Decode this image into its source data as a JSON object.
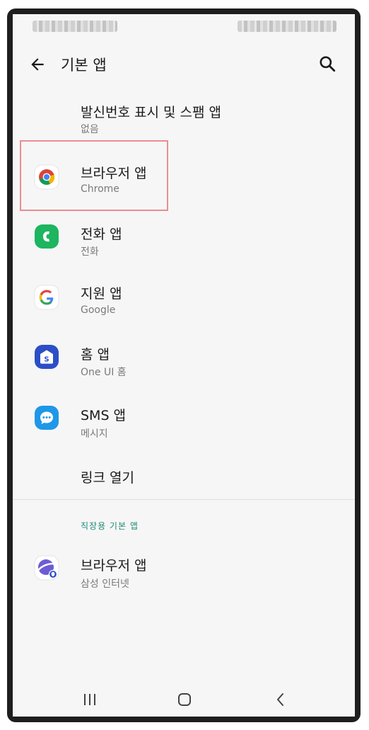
{
  "header": {
    "title": "기본 앱"
  },
  "items": [
    {
      "label": "발신번호 표시 및 스팸 앱",
      "sub": "없음"
    },
    {
      "label": "브라우저 앱",
      "sub": "Chrome"
    },
    {
      "label": "전화 앱",
      "sub": "전화"
    },
    {
      "label": "지원 앱",
      "sub": "Google"
    },
    {
      "label": "홈 앱",
      "sub": "One UI 홈"
    },
    {
      "label": "SMS 앱",
      "sub": "메시지"
    },
    {
      "label": "링크 열기"
    }
  ],
  "work_section": {
    "title": "직장용 기본 앱",
    "item": {
      "label": "브라우저 앱",
      "sub": "삼성 인터넷"
    }
  },
  "colors": {
    "highlight": "#ec8c91",
    "section_title": "#1f8a7a",
    "phone_icon": "#1db55f",
    "home_icon": "#2c4fc6",
    "sms_icon": "#1e97e8",
    "samsung_internet_icon": "#6d5bd6"
  },
  "icons": [
    "back-arrow-icon",
    "search-icon",
    "chrome-icon",
    "phone-icon",
    "google-icon",
    "samsung-home-icon",
    "messages-icon",
    "samsung-internet-icon",
    "recent-apps-icon",
    "home-nav-icon",
    "back-nav-icon"
  ]
}
